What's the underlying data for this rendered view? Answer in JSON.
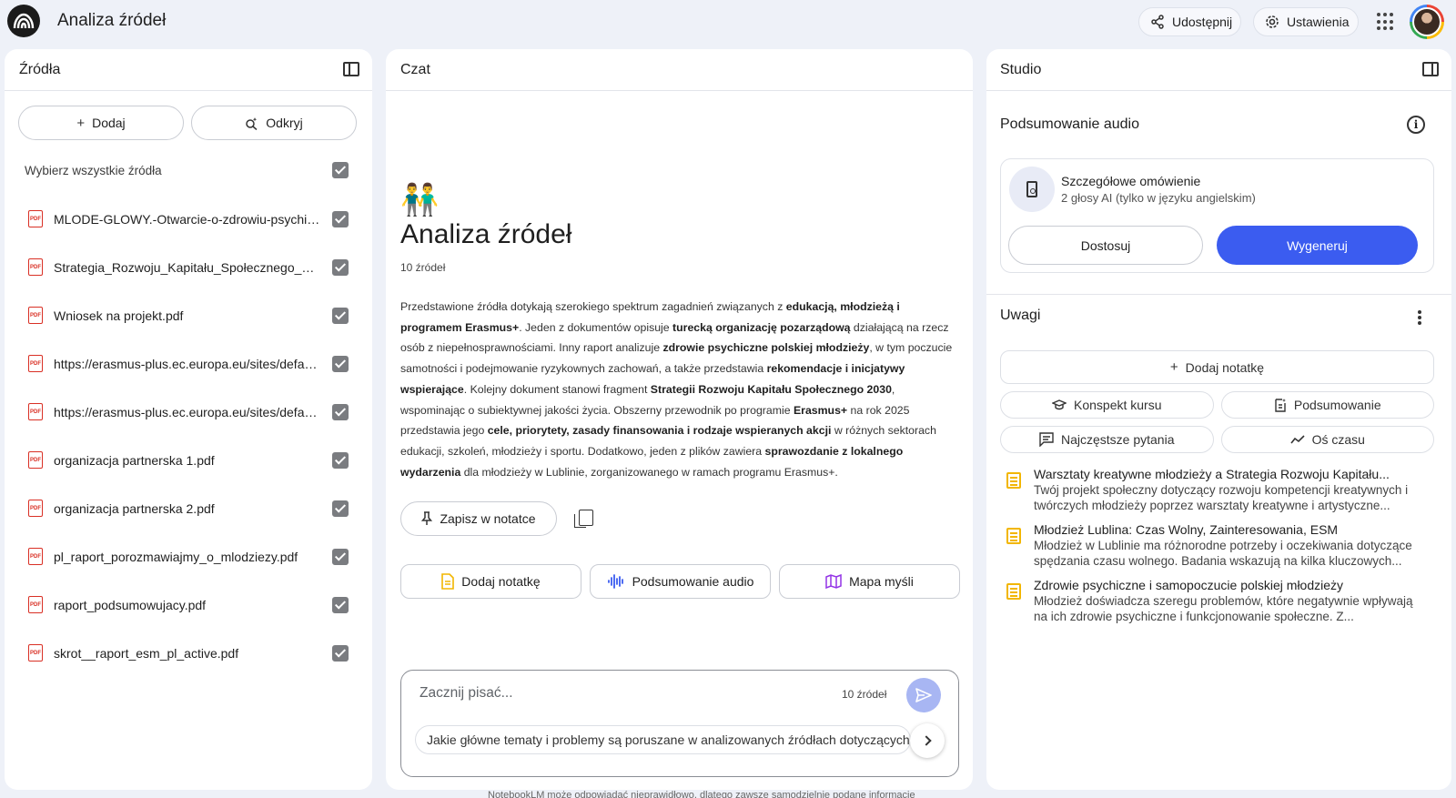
{
  "app": {
    "title": "Analiza źródeł",
    "share_label": "Udostępnij",
    "settings_label": "Ustawienia"
  },
  "sources": {
    "header": "Źródła",
    "add_label": "Dodaj",
    "discover_label": "Odkryj",
    "select_all_label": "Wybierz wszystkie źródła",
    "select_all_checked": true,
    "items": [
      {
        "name": "MLODE-GLOWY.-Otwarcie-o-zdrowiu-psychic...",
        "type": "pdf",
        "checked": true
      },
      {
        "name": "Strategia_Rozwoju_Kapitału_Społecznego_203...",
        "type": "pdf",
        "checked": true
      },
      {
        "name": "Wniosek na projekt.pdf",
        "type": "pdf",
        "checked": true
      },
      {
        "name": "https://erasmus-plus.ec.europa.eu/sites/defaul...",
        "type": "pdf",
        "checked": true
      },
      {
        "name": "https://erasmus-plus.ec.europa.eu/sites/defaul...",
        "type": "pdf",
        "checked": true
      },
      {
        "name": "organizacja partnerska 1.pdf",
        "type": "pdf",
        "checked": true
      },
      {
        "name": "organizacja partnerska 2.pdf",
        "type": "pdf",
        "checked": true
      },
      {
        "name": "pl_raport_porozmawiajmy_o_mlodziezy.pdf",
        "type": "pdf",
        "checked": true
      },
      {
        "name": "raport_podsumowujacy.pdf",
        "type": "pdf",
        "checked": true
      },
      {
        "name": "skrot__raport_esm_pl_active.pdf",
        "type": "pdf",
        "checked": true
      }
    ]
  },
  "chat": {
    "header": "Czat",
    "emoji": "👬",
    "title": "Analiza źródeł",
    "source_count": "10 źródeł",
    "summary": [
      {
        "t": "Przedstawione źródła dotykają szerokiego spektrum zagadnień związanych z ",
        "b": false
      },
      {
        "t": "edukacją, młodzieżą i programem Erasmus+",
        "b": true
      },
      {
        "t": ". Jeden z dokumentów opisuje ",
        "b": false
      },
      {
        "t": "turecką organizację pozarządową",
        "b": true
      },
      {
        "t": " działającą na rzecz osób z niepełnosprawnościami. Inny raport analizuje ",
        "b": false
      },
      {
        "t": "zdrowie psychiczne polskiej młodzieży",
        "b": true
      },
      {
        "t": ", w tym poczucie samotności i podejmowanie ryzykownych zachowań, a także przedstawia ",
        "b": false
      },
      {
        "t": "rekomendacje i inicjatywy wspierające",
        "b": true
      },
      {
        "t": ". Kolejny dokument stanowi fragment ",
        "b": false
      },
      {
        "t": "Strategii Rozwoju Kapitału Społecznego 2030",
        "b": true
      },
      {
        "t": ", wspominając o subiektywnej jakości życia. Obszerny przewodnik po programie ",
        "b": false
      },
      {
        "t": "Erasmus+",
        "b": true
      },
      {
        "t": " na rok 2025 przedstawia jego ",
        "b": false
      },
      {
        "t": "cele, priorytety, zasady finansowania i rodzaje wspieranych akcji",
        "b": true
      },
      {
        "t": " w różnych sektorach edukacji, szkoleń, młodzieży i sportu. Dodatkowo, jeden z plików zawiera ",
        "b": false
      },
      {
        "t": "sprawozdanie z lokalnego wydarzenia",
        "b": true
      },
      {
        "t": " dla młodzieży w Lublinie, zorganizowanego w ramach programu Erasmus+.",
        "b": false
      }
    ],
    "save_note_label": "Zapisz w notatce",
    "actions": {
      "add_note": "Dodaj notatkę",
      "audio_summary": "Podsumowanie audio",
      "mind_map": "Mapa myśli"
    },
    "composer": {
      "placeholder": "Zacznij pisać...",
      "source_count": "10 źródeł",
      "suggestion": "Jakie główne tematy i problemy są poruszane w analizowanych źródłach dotyczących młodzieży?"
    },
    "footer": "NotebookLM może odpowiadać nieprawidłowo, dlatego zawsze samodzielnie podane informacje"
  },
  "studio": {
    "header": "Studio",
    "audio_section_title": "Podsumowanie audio",
    "audio_card": {
      "name": "Szczegółowe omówienie",
      "subtitle": "2 głosy AI (tylko w języku angielskim)",
      "customize_label": "Dostosuj",
      "generate_label": "Wygeneruj"
    },
    "notes_title": "Uwagi",
    "add_note_label": "Dodaj notatkę",
    "tools": [
      {
        "label": "Konspekt kursu",
        "icon": "graduation-cap-icon"
      },
      {
        "label": "Podsumowanie",
        "icon": "doc-summary-icon"
      },
      {
        "label": "Najczęstsze pytania",
        "icon": "faq-icon"
      },
      {
        "label": "Oś czasu",
        "icon": "timeline-icon"
      }
    ],
    "notes": [
      {
        "title": "Warsztaty kreatywne młodzieży a Strategia Rozwoju Kapitału...",
        "body": "Twój projekt społeczny dotyczący rozwoju kompetencji kreatywnych i twórczych młodzieży poprzez warsztaty kreatywne i artystyczne..."
      },
      {
        "title": "Młodzież Lublina: Czas Wolny, Zainteresowania, ESM",
        "body": "Młodzież w Lublinie ma różnorodne potrzeby i oczekiwania dotyczące spędzania czasu wolnego. Badania wskazują na kilka kluczowych..."
      },
      {
        "title": "Zdrowie psychiczne i samopoczucie polskiej młodzieży",
        "body": "Młodzież doświadcza szeregu problemów, które negatywnie wpływają na ich zdrowie psychiczne i funkcjonowanie społeczne. Z..."
      }
    ]
  },
  "colors": {
    "accent": "#3b5cf0",
    "background": "#eef1f8",
    "pdf_red": "#d93025",
    "note_yellow": "#f2b600"
  }
}
